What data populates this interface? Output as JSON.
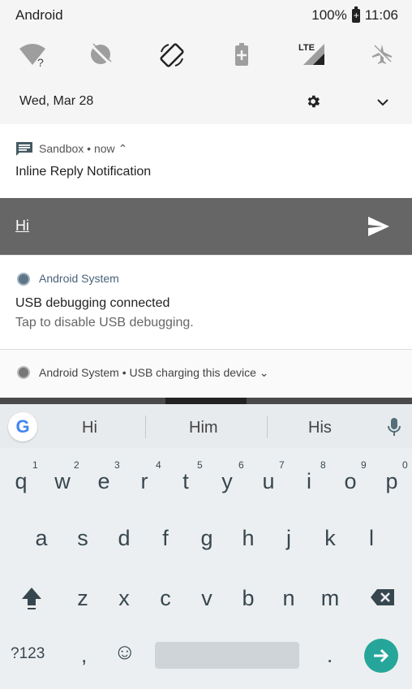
{
  "status_bar": {
    "carrier": "Android",
    "battery": "100%",
    "battery_glyph": "+",
    "time": "11:06"
  },
  "quick_settings": {
    "tiles": [
      "wifi-unknown-icon",
      "sync-off-icon",
      "auto-rotate-icon",
      "battery-saver-icon",
      "lte-signal-icon",
      "airplane-mode-icon"
    ],
    "lte_label": "LTE",
    "wifi_question": "?",
    "date": "Wed, Mar 28"
  },
  "notifications": [
    {
      "app": "Sandbox • now ⌃",
      "title": "Inline Reply Notification"
    },
    {
      "app": "Android System",
      "title": "USB debugging connected",
      "subtitle": "Tap to disable USB debugging."
    },
    {
      "summary": "Android System • USB charging this device ⌄"
    }
  ],
  "reply": {
    "text": "Hi"
  },
  "keyboard": {
    "logo": "G",
    "suggestions": [
      "Hi",
      "Him",
      "His"
    ],
    "row1": [
      "q",
      "w",
      "e",
      "r",
      "t",
      "y",
      "u",
      "i",
      "o",
      "p"
    ],
    "row1_numbers": [
      "1",
      "2",
      "3",
      "4",
      "5",
      "6",
      "7",
      "8",
      "9",
      "0"
    ],
    "row2": [
      "a",
      "s",
      "d",
      "f",
      "g",
      "h",
      "j",
      "k",
      "l"
    ],
    "row3": [
      "z",
      "x",
      "c",
      "v",
      "b",
      "n",
      "m"
    ],
    "bottom": {
      "symbols": "?123",
      "comma": ",",
      "emoji": "☺",
      "period": "."
    }
  },
  "colors": {
    "reply_bar": "#666666",
    "enter_key": "#26a69a",
    "app_name_blue": "#48627a"
  }
}
